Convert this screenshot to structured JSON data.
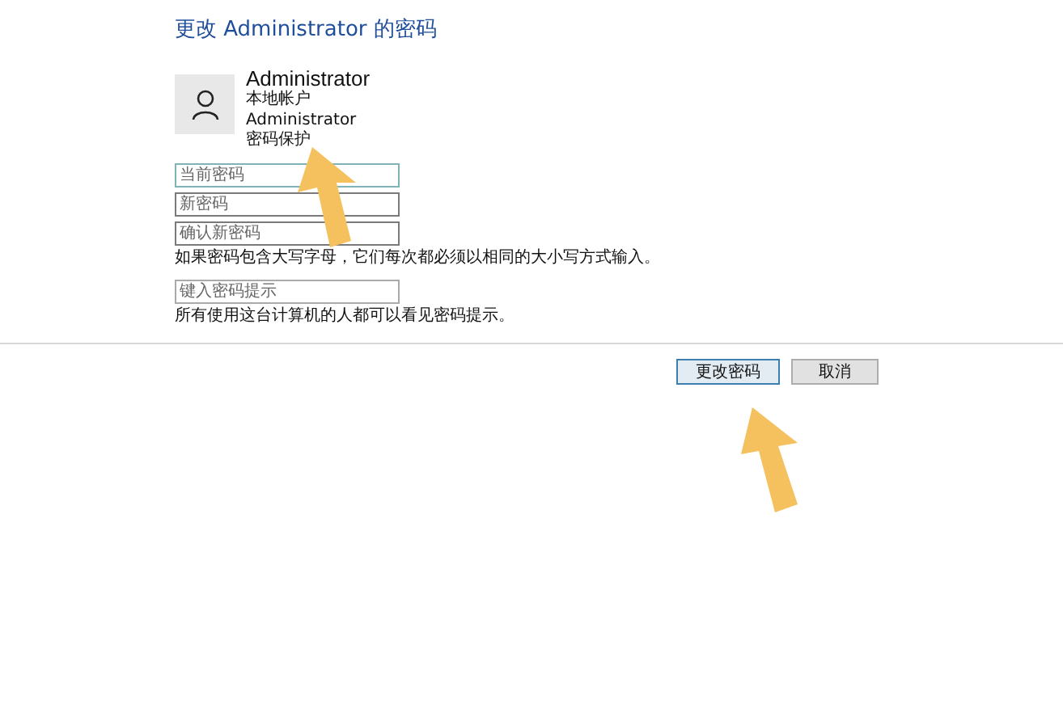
{
  "title": "更改 Administrator 的密码",
  "account": {
    "name": "Administrator",
    "type": "本地帐户",
    "username": "Administrator",
    "status": "密码保护"
  },
  "fields": [
    {
      "placeholder": "当前密码",
      "focused": true
    },
    {
      "placeholder": "新密码",
      "focused": false
    },
    {
      "placeholder": "确认新密码",
      "focused": false
    }
  ],
  "case_note": "如果密码包含大写字母，它们每次都必须以相同的大小写方式输入。",
  "hint_field": {
    "placeholder": "键入密码提示"
  },
  "hint_note": "所有使用这台计算机的人都可以看见密码提示。",
  "buttons": [
    {
      "label": "更改密码",
      "default": true
    },
    {
      "label": "取消",
      "default": false
    }
  ]
}
